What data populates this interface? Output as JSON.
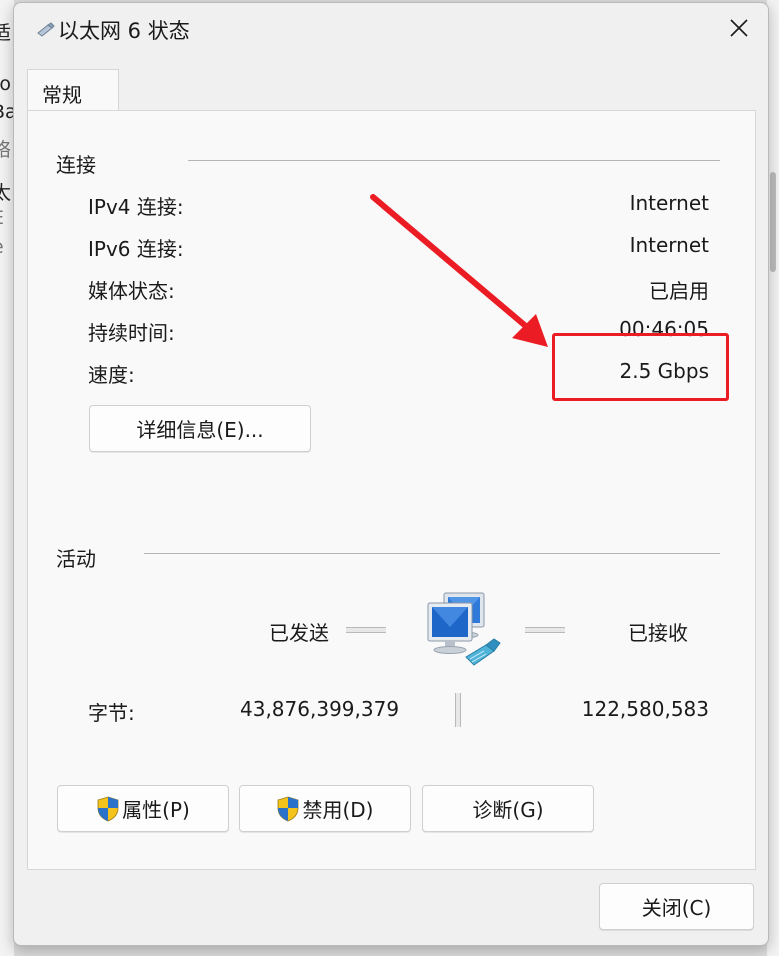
{
  "background": {
    "lines": [
      "ro",
      "Ba",
      "络",
      "太",
      "E",
      "e",
      "适"
    ]
  },
  "window": {
    "title": "以太网 6 状态",
    "icons": {
      "title": "network-adapter-icon",
      "close": "close-icon"
    }
  },
  "tabs": [
    {
      "label": "常规",
      "selected": true
    }
  ],
  "connection": {
    "title": "连接",
    "rows": [
      {
        "label": "IPv4 连接:",
        "value": "Internet"
      },
      {
        "label": "IPv6 连接:",
        "value": "Internet"
      },
      {
        "label": "媒体状态:",
        "value": "已启用"
      },
      {
        "label": "持续时间:",
        "value": "00:46:05"
      },
      {
        "label": "速度:",
        "value": "2.5 Gbps"
      }
    ],
    "details_button": "详细信息(E)..."
  },
  "activity": {
    "title": "活动",
    "sent_label": "已发送",
    "received_label": "已接收",
    "bytes_label": "字节:",
    "bytes_sent": "43,876,399,379",
    "bytes_received": "122,580,583",
    "icon": "network-computers-icon"
  },
  "buttons": {
    "properties": "属性(P)",
    "disable": "禁用(D)",
    "diagnose": "诊断(G)",
    "close": "关闭(C)",
    "shield_icon": "uac-shield-icon"
  },
  "annotation": {
    "color": "#ec1c24"
  }
}
